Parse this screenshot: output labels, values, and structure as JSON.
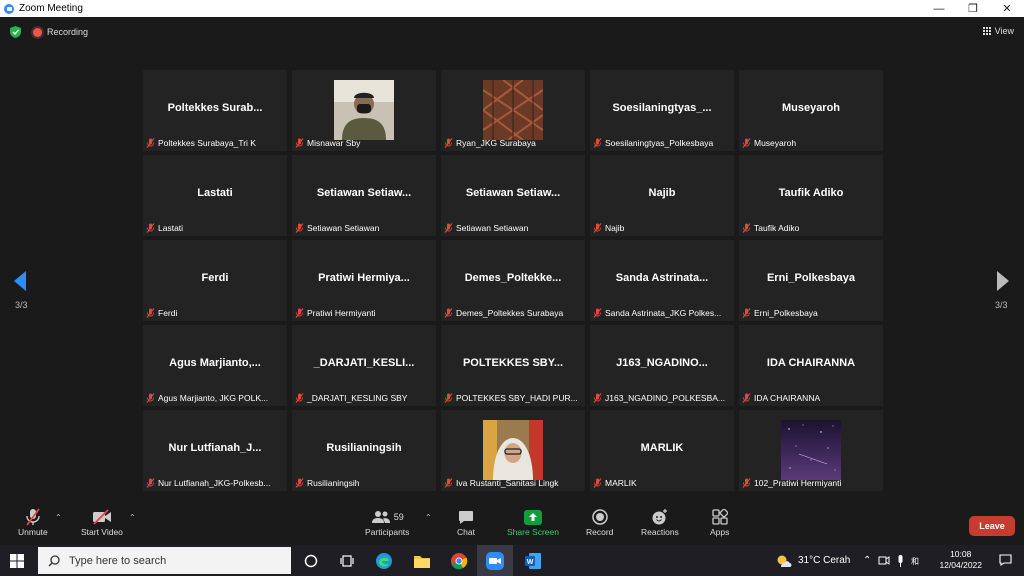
{
  "window": {
    "title": "Zoom Meeting"
  },
  "meeting": {
    "recording_label": "Recording",
    "view_label": "View"
  },
  "pagination": {
    "left_label": "3/3",
    "right_label": "3/3"
  },
  "participants": [
    {
      "name": "Poltekkes  Surab...",
      "label": "Poltekkes Surabaya_Tri K",
      "video": false
    },
    {
      "name": "",
      "label": "Misnawar Sby",
      "video": true,
      "video_type": "person-mask"
    },
    {
      "name": "",
      "label": "Ryan_JKG Surabaya",
      "video": true,
      "video_type": "wood-texture"
    },
    {
      "name": "Soesilaningtyas_...",
      "label": "Soesilaningtyas_Polkesbaya",
      "video": false
    },
    {
      "name": "Museyaroh",
      "label": "Museyaroh",
      "video": false
    },
    {
      "name": "Lastati",
      "label": "Lastati",
      "video": false
    },
    {
      "name": "Setiawan  Setiaw...",
      "label": "Setiawan Setiawan",
      "video": false
    },
    {
      "name": "Setiawan  Setiaw...",
      "label": "Setiawan Setiawan",
      "video": false
    },
    {
      "name": "Najib",
      "label": "Najib",
      "video": false
    },
    {
      "name": "Taufik Adiko",
      "label": "Taufik Adiko",
      "video": false
    },
    {
      "name": "Ferdi",
      "label": "Ferdi",
      "video": false
    },
    {
      "name": "Pratiwi  Hermiya...",
      "label": "Pratiwi Hermiyanti",
      "video": false
    },
    {
      "name": "Demes_Poltekke...",
      "label": "Demes_Poltekkes Surabaya",
      "video": false
    },
    {
      "name": "Sanda  Astrinata...",
      "label": "Sanda Astrinata_JKG Polkes...",
      "video": false
    },
    {
      "name": "Erni_Polkesbaya",
      "label": "Erni_Polkesbaya",
      "video": false
    },
    {
      "name": "Agus  Marjianto,...",
      "label": "Agus Marjianto, JKG POLK...",
      "video": false
    },
    {
      "name": "_DARJATI_KESLI...",
      "label": "_DARJATI_KESLING SBY",
      "video": false
    },
    {
      "name": "POLTEKKES  SBY...",
      "label": "POLTEKKES SBY_HADI PUR...",
      "video": false
    },
    {
      "name": "J163_NGADINO...",
      "label": "J163_NGADINO_POLKESBA...",
      "video": false
    },
    {
      "name": "IDA CHAIRANNA",
      "label": "IDA CHAIRANNA",
      "video": false
    },
    {
      "name": "Nur  Lutfianah_J...",
      "label": "Nur Lutfianah_JKG-Polkesb...",
      "video": false
    },
    {
      "name": "Rusilianingsih",
      "label": "Rusilianingsih",
      "video": false
    },
    {
      "name": "",
      "label": "Iva Rustanti_Sanitasi Lingk",
      "video": true,
      "video_type": "person-hijab"
    },
    {
      "name": "MARLIK",
      "label": "MARLIK",
      "video": false
    },
    {
      "name": "",
      "label": "102_Pratiwi Hermiyanti",
      "video": true,
      "video_type": "starfield"
    }
  ],
  "toolbar": {
    "unmute": "Unmute",
    "start_video": "Start Video",
    "participants": "Participants",
    "participants_count": "59",
    "chat": "Chat",
    "share_screen": "Share Screen",
    "record": "Record",
    "reactions": "Reactions",
    "apps": "Apps",
    "leave": "Leave"
  },
  "taskbar": {
    "search_placeholder": "Type here to search",
    "weather": "31°C  Cerah",
    "time": "10:08",
    "date": "12/04/2022"
  },
  "colors": {
    "accent_blue": "#2d8cff",
    "share_green": "#0e9f3c",
    "leave_red": "#c73b31",
    "mic_muted_red": "#e04a3f"
  }
}
